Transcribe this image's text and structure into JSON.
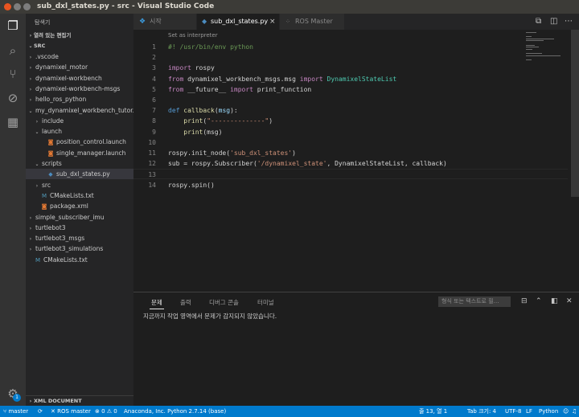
{
  "window": {
    "title": "sub_dxl_states.py - src - Visual Studio Code"
  },
  "colors": {
    "accent": "#007acc",
    "close_dot": "#e95420",
    "min_dot": "#7d7d7d",
    "max_dot": "#7d7d7d"
  },
  "activity_bar": {
    "items": [
      {
        "name": "explorer-icon",
        "glyph": "❐"
      },
      {
        "name": "search-icon",
        "glyph": "⌕"
      },
      {
        "name": "source-control-icon",
        "glyph": "⑂"
      },
      {
        "name": "debug-icon",
        "glyph": "⊘"
      },
      {
        "name": "extensions-icon",
        "glyph": "▦"
      }
    ],
    "gear_badge": "1"
  },
  "sidebar": {
    "title": "탐색기",
    "open_editors": "열려 있는 편집기",
    "root": "SRC",
    "tree": [
      {
        "label": ".vscode",
        "depth": 1,
        "arrow": "›",
        "icon": ""
      },
      {
        "label": "dynamixel_motor",
        "depth": 1,
        "arrow": "›",
        "icon": ""
      },
      {
        "label": "dynamixel-workbench",
        "depth": 1,
        "arrow": "›",
        "icon": ""
      },
      {
        "label": "dynamixel-workbench-msgs",
        "depth": 1,
        "arrow": "›",
        "icon": ""
      },
      {
        "label": "hello_ros_python",
        "depth": 1,
        "arrow": "›",
        "icon": ""
      },
      {
        "label": "my_dynamixel_workbench_tutor...",
        "depth": 1,
        "arrow": "⌄",
        "icon": ""
      },
      {
        "label": "include",
        "depth": 2,
        "arrow": "›",
        "icon": ""
      },
      {
        "label": "launch",
        "depth": 2,
        "arrow": "⌄",
        "icon": ""
      },
      {
        "label": "position_control.launch",
        "depth": 3,
        "arrow": "",
        "icon": "rss"
      },
      {
        "label": "single_manager.launch",
        "depth": 3,
        "arrow": "",
        "icon": "rss"
      },
      {
        "label": "scripts",
        "depth": 2,
        "arrow": "⌄",
        "icon": ""
      },
      {
        "label": "sub_dxl_states.py",
        "depth": 3,
        "arrow": "",
        "icon": "py",
        "selected": true
      },
      {
        "label": "src",
        "depth": 2,
        "arrow": "›",
        "icon": ""
      },
      {
        "label": "CMakeLists.txt",
        "depth": 2,
        "arrow": "",
        "icon": "cmake"
      },
      {
        "label": "package.xml",
        "depth": 2,
        "arrow": "",
        "icon": "rss"
      },
      {
        "label": "simple_subscriber_imu",
        "depth": 1,
        "arrow": "›",
        "icon": ""
      },
      {
        "label": "turtlebot3",
        "depth": 1,
        "arrow": "›",
        "icon": ""
      },
      {
        "label": "turtlebot3_msgs",
        "depth": 1,
        "arrow": "›",
        "icon": ""
      },
      {
        "label": "turtlebot3_simulations",
        "depth": 1,
        "arrow": "›",
        "icon": ""
      },
      {
        "label": "CMakeLists.txt",
        "depth": 1,
        "arrow": "",
        "icon": "cmake"
      }
    ],
    "bottom_section": "XML DOCUMENT"
  },
  "tabs": [
    {
      "label": "시작",
      "icon": "vscode"
    },
    {
      "label": "sub_dxl_states.py",
      "icon": "py",
      "active": true,
      "close": "×"
    },
    {
      "label": "ROS Master",
      "icon": "ros"
    }
  ],
  "editor": {
    "codelens": "Set as interpreter",
    "current_line": 13,
    "lines": [
      {
        "n": "1",
        "tokens": [
          [
            "cmt",
            "#! /usr/bin/env python"
          ]
        ]
      },
      {
        "n": "2",
        "tokens": []
      },
      {
        "n": "3",
        "tokens": [
          [
            "kw",
            "import"
          ],
          [
            "plain",
            " rospy"
          ]
        ]
      },
      {
        "n": "4",
        "tokens": [
          [
            "kw",
            "from"
          ],
          [
            "plain",
            " dynamixel_workbench_msgs.msg "
          ],
          [
            "kw",
            "import"
          ],
          [
            "plain",
            " "
          ],
          [
            "cls",
            "DynamixelStateList"
          ]
        ]
      },
      {
        "n": "5",
        "tokens": [
          [
            "kw",
            "from"
          ],
          [
            "plain",
            " __future__ "
          ],
          [
            "kw",
            "import"
          ],
          [
            "plain",
            " print_function"
          ]
        ]
      },
      {
        "n": "6",
        "tokens": []
      },
      {
        "n": "7",
        "tokens": [
          [
            "def",
            "def"
          ],
          [
            "plain",
            " "
          ],
          [
            "fn",
            "callback"
          ],
          [
            "plain",
            "("
          ],
          [
            "var",
            "msg"
          ],
          [
            "plain",
            "):"
          ]
        ]
      },
      {
        "n": "8",
        "tokens": [
          [
            "plain",
            "    "
          ],
          [
            "fn",
            "print"
          ],
          [
            "plain",
            "("
          ],
          [
            "str",
            "\"--------------\""
          ],
          [
            "plain",
            ")"
          ]
        ]
      },
      {
        "n": "9",
        "tokens": [
          [
            "plain",
            "    "
          ],
          [
            "fn",
            "print"
          ],
          [
            "plain",
            "(msg)"
          ]
        ]
      },
      {
        "n": "10",
        "tokens": []
      },
      {
        "n": "11",
        "tokens": [
          [
            "plain",
            "rospy.init_node("
          ],
          [
            "str",
            "'sub_dxl_states'"
          ],
          [
            "plain",
            ")"
          ]
        ]
      },
      {
        "n": "12",
        "tokens": [
          [
            "plain",
            "sub = rospy.Subscriber("
          ],
          [
            "str",
            "'/dynamixel_state'"
          ],
          [
            "plain",
            ", DynamixelStateList, callback)"
          ]
        ]
      },
      {
        "n": "13",
        "tokens": []
      },
      {
        "n": "14",
        "tokens": [
          [
            "plain",
            "rospy.spin()"
          ]
        ]
      }
    ]
  },
  "panel": {
    "tabs": [
      "문제",
      "출력",
      "디버그 콘솔",
      "터미널"
    ],
    "active_tab": 0,
    "filter_placeholder": "형식 또는 텍스트로 필…",
    "message": "지금까지 작업 영역에서 문제가 감지되지 않았습니다."
  },
  "status_bar": {
    "branch": "master",
    "ros_master": "ROS master",
    "errors": "0",
    "warnings": "0",
    "interpreter": "Anaconda, Inc. Python 2.7.14 (base)",
    "position": "줄 13, 열 1",
    "tab_size": "Tab 크기: 4",
    "encoding": "UTF-8",
    "eol": "LF",
    "language": "Python"
  }
}
